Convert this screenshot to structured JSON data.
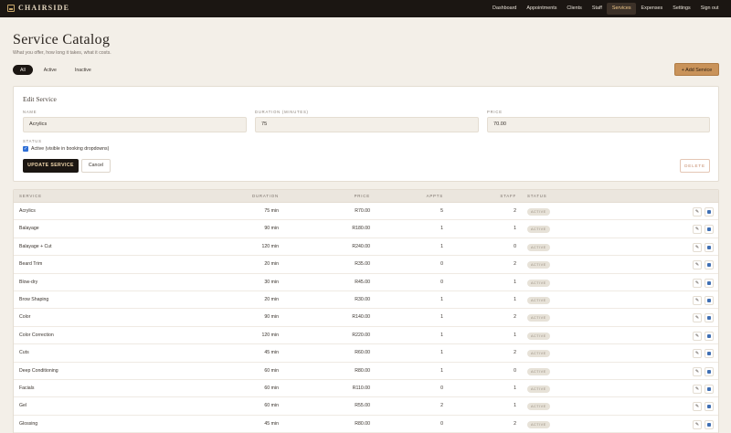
{
  "brand": {
    "name": "CHAIRSIDE"
  },
  "nav": [
    {
      "label": "Dashboard",
      "active": false
    },
    {
      "label": "Appointments",
      "active": false
    },
    {
      "label": "Clients",
      "active": false
    },
    {
      "label": "Staff",
      "active": false
    },
    {
      "label": "Services",
      "active": true
    },
    {
      "label": "Expenses",
      "active": false
    },
    {
      "label": "Settings",
      "active": false
    },
    {
      "label": "Sign out",
      "active": false
    }
  ],
  "header": {
    "title": "Service Catalog",
    "subtitle": "What you offer, how long it takes, what it costs."
  },
  "filters": [
    {
      "label": "All",
      "active": true
    },
    {
      "label": "Active",
      "active": false
    },
    {
      "label": "Inactive",
      "active": false
    }
  ],
  "add_button": "+ Add Service",
  "edit": {
    "title": "Edit Service",
    "name_label": "NAME",
    "name_value": "Acrylics",
    "duration_label": "DURATION (MINUTES)",
    "duration_value": "75",
    "price_label": "PRICE",
    "price_value": "70.00",
    "status_label": "STATUS",
    "checkbox_label": "Active (visible in booking dropdowns)",
    "checkbox_checked": true,
    "update_label": "UPDATE SERVICE",
    "cancel_label": "Cancel",
    "delete_label": "DELETE"
  },
  "table": {
    "headers": {
      "service": "SERVICE",
      "duration": "DURATION",
      "price": "PRICE",
      "appts": "APPTS",
      "staff": "STAFF",
      "status": "STATUS"
    },
    "rows": [
      {
        "service": "Acrylics",
        "duration": "75 min",
        "price": "R70.00",
        "appts": "5",
        "staff": "2",
        "status": "ACTIVE"
      },
      {
        "service": "Balayage",
        "duration": "90 min",
        "price": "R180.00",
        "appts": "1",
        "staff": "1",
        "status": "ACTIVE"
      },
      {
        "service": "Balayage + Cut",
        "duration": "120 min",
        "price": "R240.00",
        "appts": "1",
        "staff": "0",
        "status": "ACTIVE"
      },
      {
        "service": "Beard Trim",
        "duration": "20 min",
        "price": "R35.00",
        "appts": "0",
        "staff": "2",
        "status": "ACTIVE"
      },
      {
        "service": "Blow-dry",
        "duration": "30 min",
        "price": "R45.00",
        "appts": "0",
        "staff": "1",
        "status": "ACTIVE"
      },
      {
        "service": "Brow Shaping",
        "duration": "20 min",
        "price": "R30.00",
        "appts": "1",
        "staff": "1",
        "status": "ACTIVE"
      },
      {
        "service": "Color",
        "duration": "90 min",
        "price": "R140.00",
        "appts": "1",
        "staff": "2",
        "status": "ACTIVE"
      },
      {
        "service": "Color Correction",
        "duration": "120 min",
        "price": "R220.00",
        "appts": "1",
        "staff": "1",
        "status": "ACTIVE"
      },
      {
        "service": "Cuts",
        "duration": "45 min",
        "price": "R60.00",
        "appts": "1",
        "staff": "2",
        "status": "ACTIVE"
      },
      {
        "service": "Deep Conditioning",
        "duration": "60 min",
        "price": "R80.00",
        "appts": "1",
        "staff": "0",
        "status": "ACTIVE"
      },
      {
        "service": "Facials",
        "duration": "60 min",
        "price": "R110.00",
        "appts": "0",
        "staff": "1",
        "status": "ACTIVE"
      },
      {
        "service": "Gel",
        "duration": "60 min",
        "price": "R55.00",
        "appts": "2",
        "staff": "1",
        "status": "ACTIVE"
      },
      {
        "service": "Glossing",
        "duration": "45 min",
        "price": "R80.00",
        "appts": "0",
        "staff": "2",
        "status": "ACTIVE"
      }
    ],
    "edit_icon": "pencil-icon",
    "delete_icon": "trash-icon"
  }
}
